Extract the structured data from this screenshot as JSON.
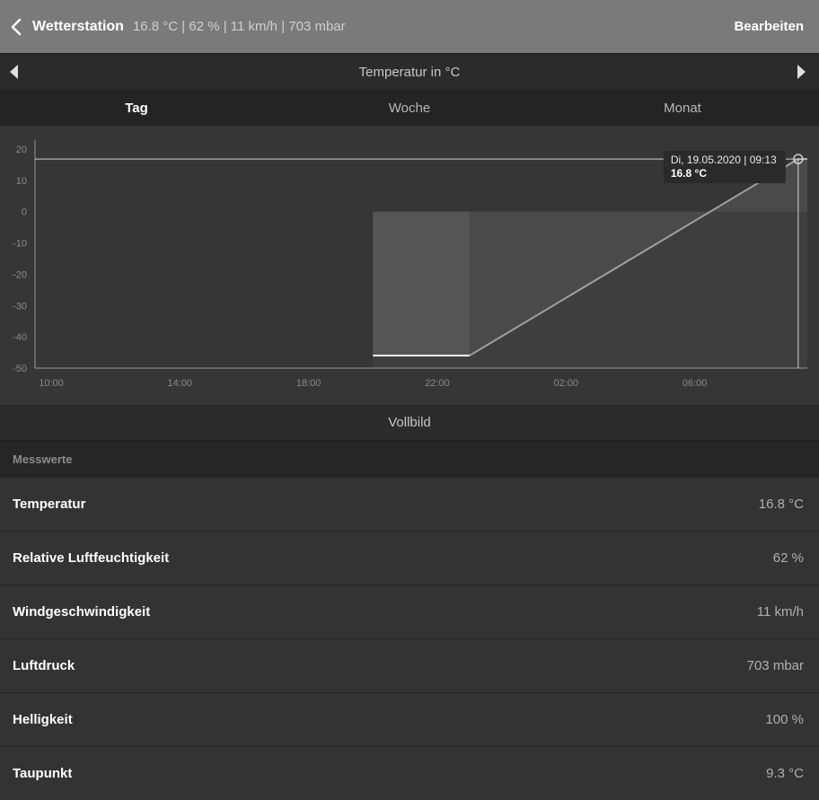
{
  "header": {
    "title": "Wetterstation",
    "subtitle": "16.8 °C | 62 % | 11 km/h | 703 mbar",
    "edit_label": "Bearbeiten"
  },
  "chart_header": {
    "title": "Temperatur in °C"
  },
  "tabs": [
    {
      "label": "Tag",
      "active": true
    },
    {
      "label": "Woche",
      "active": false
    },
    {
      "label": "Monat",
      "active": false
    }
  ],
  "chart_data": {
    "type": "line",
    "x": [
      "20:00",
      "23:00",
      "09:13"
    ],
    "series": [
      {
        "values": [
          -46,
          -46,
          16.8
        ]
      }
    ],
    "ylim": [
      -50,
      20
    ],
    "yticks": [
      "20",
      "10",
      "0",
      "-10",
      "-20",
      "-30",
      "-40",
      "-50"
    ],
    "xticks": [
      "10:00",
      "14:00",
      "18:00",
      "22:00",
      "02:00",
      "06:00"
    ],
    "tooltip": {
      "date": "Di, 19.05.2020 | 09:13",
      "value": "16.8 °C"
    }
  },
  "fullscreen_label": "Vollbild",
  "section_title": "Messwerte",
  "measurements": [
    {
      "label": "Temperatur",
      "value": "16.8 °C"
    },
    {
      "label": "Relative Luftfeuchtigkeit",
      "value": "62 %"
    },
    {
      "label": "Windgeschwindigkeit",
      "value": "11 km/h"
    },
    {
      "label": "Luftdruck",
      "value": "703 mbar"
    },
    {
      "label": "Helligkeit",
      "value": "100 %"
    },
    {
      "label": "Taupunkt",
      "value": "9.3 °C"
    }
  ],
  "colors": {
    "header_bg": "#7a7a7a",
    "chart_bg": "#363636",
    "line": "#a0a0a0",
    "fill": "#4a4a4a"
  }
}
